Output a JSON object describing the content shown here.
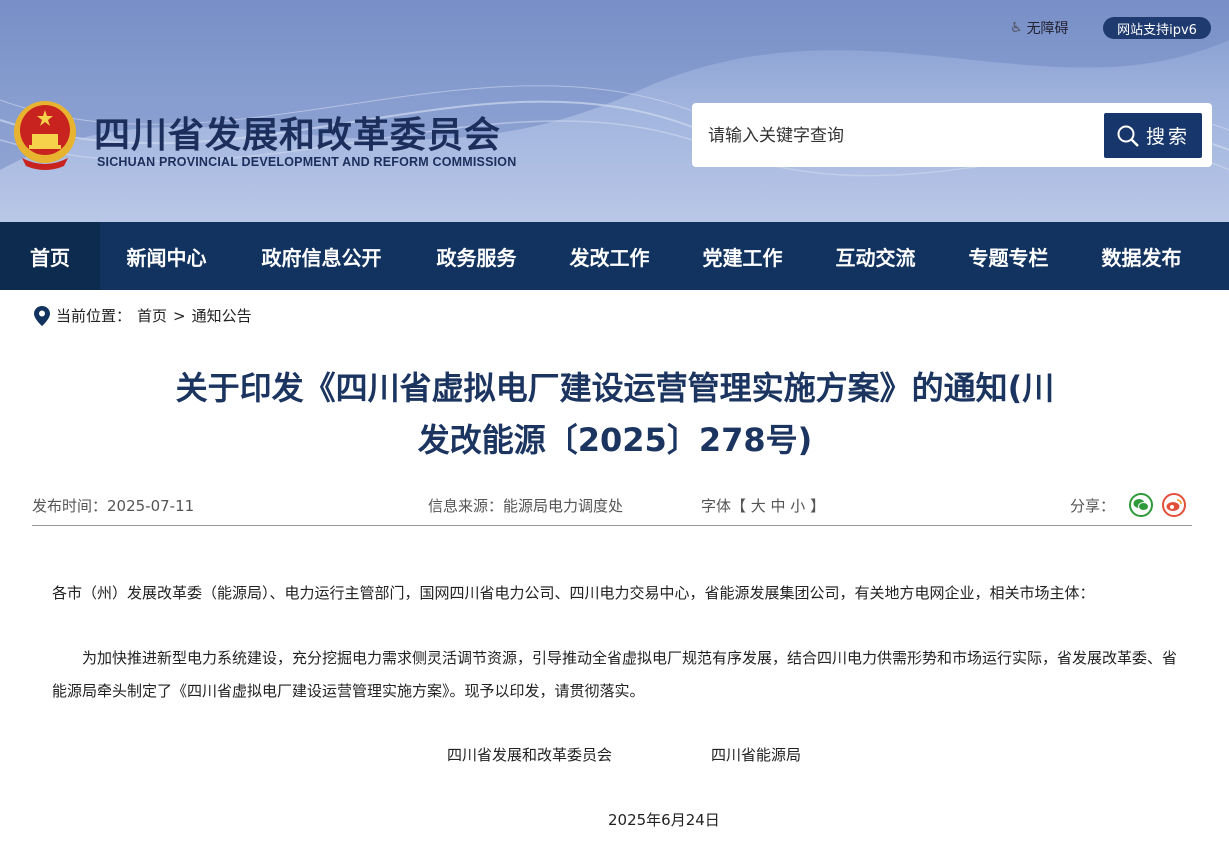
{
  "header": {
    "accessibility_label": "无障碍",
    "ipv6_label": "网站支持ipv6",
    "site_title": "四川省发展和改革委员会",
    "site_subtitle": "SICHUAN PROVINCIAL DEVELOPMENT AND REFORM COMMISSION",
    "search_placeholder": "请输入关键字查询",
    "search_button": "搜索"
  },
  "nav": {
    "items": [
      "首页",
      "新闻中心",
      "政府信息公开",
      "政务服务",
      "发改工作",
      "党建工作",
      "互动交流",
      "专题专栏",
      "数据发布"
    ]
  },
  "breadcrumb": {
    "prefix": "当前位置：",
    "home": "首页",
    "separator": ">",
    "current": "通知公告"
  },
  "article": {
    "title_line1": "关于印发《四川省虚拟电厂建设运营管理实施方案》的通知(川",
    "title_line2": "发改能源〔2025〕278号)",
    "publish_time": "发布时间：2025-07-11",
    "source": "信息来源：能源局电力调度处",
    "font_size_label": "字体【 大  中  小 】",
    "share_label": "分享：",
    "paragraph1": "各市（州）发展改革委（能源局）、电力运行主管部门，国网四川省电力公司、四川电力交易中心，省能源发展集团公司，有关地方电网企业，相关市场主体：",
    "paragraph2": "为加快推进新型电力系统建设，充分挖掘电力需求侧灵活调节资源，引导推动全省虚拟电厂规范有序发展，结合四川电力供需形势和市场运行实际，省发展改革委、省能源局牵头制定了《四川省虚拟电厂建设运营管理实施方案》。现予以印发，请贯彻落实。",
    "signer1": "四川省发展和改革委员会",
    "signer2": "四川省能源局",
    "sign_date": "2025年6月24日"
  },
  "colors": {
    "nav_bg": "#12335f",
    "title_color": "#1b3560",
    "wechat": "#2e9a3a",
    "weibo": "#e2503a"
  }
}
